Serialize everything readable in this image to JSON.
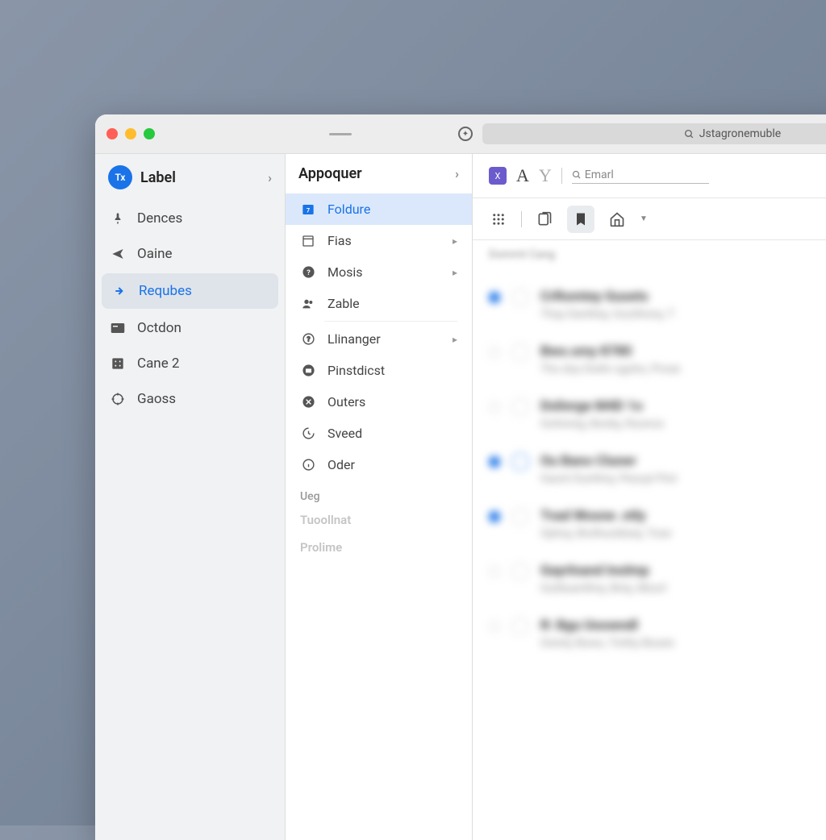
{
  "titlebar": {
    "search_text": "Jstagronemuble"
  },
  "sidebar": {
    "label": "Label",
    "items": [
      {
        "label": "Dences"
      },
      {
        "label": "Oaine"
      },
      {
        "label": "Requbes"
      },
      {
        "label": "Octdon"
      },
      {
        "label": "Cane 2"
      },
      {
        "label": "Gaoss"
      }
    ]
  },
  "panel": {
    "title": "Appoquer",
    "items": [
      {
        "label": "Foldure"
      },
      {
        "label": "Fias"
      },
      {
        "label": "Mosis"
      },
      {
        "label": "Zable"
      },
      {
        "label": "Llinanger"
      },
      {
        "label": "Pinstdicst"
      },
      {
        "label": "Outers"
      },
      {
        "label": "Sveed"
      },
      {
        "label": "Oder"
      }
    ],
    "heading": "Ueg",
    "muted1": "Tuoollnat",
    "muted2": "Prolime"
  },
  "main": {
    "email_placeholder": "Emarl",
    "blurred_tag": "Dommt  Cang",
    "messages": [
      {
        "title": "CrRomtey Gusets",
        "sub": "Thay Danthey, Gozithony, T",
        "unread": true,
        "ring": false
      },
      {
        "title": "Bwo.smy 8780",
        "sub": "Tho doy Dwltn sgoho, Prose",
        "unread": false,
        "ring": false
      },
      {
        "title": "Dslinrge M4D 1o",
        "sub": "Gohining, Bonby, Ruonos",
        "unread": false,
        "ring": false
      },
      {
        "title": "Ou Bano Cluner",
        "sub": "Gaont Dunthny, Peouyt Piot",
        "unread": true,
        "ring": true
      },
      {
        "title": "Tvad Wosne .ntly",
        "sub": "Ophoy, Brolhuoldoey, Tose",
        "unread": true,
        "ring": false
      },
      {
        "title": "Gayrlnand Inolmp",
        "sub": "Guhbuenlhny, Bnty, Moorl",
        "unread": false,
        "ring": false
      },
      {
        "title": "R: Bgu Uoowndl",
        "sub": "Grenty Bows, Tinthy Booen",
        "unread": false,
        "ring": false
      }
    ]
  }
}
